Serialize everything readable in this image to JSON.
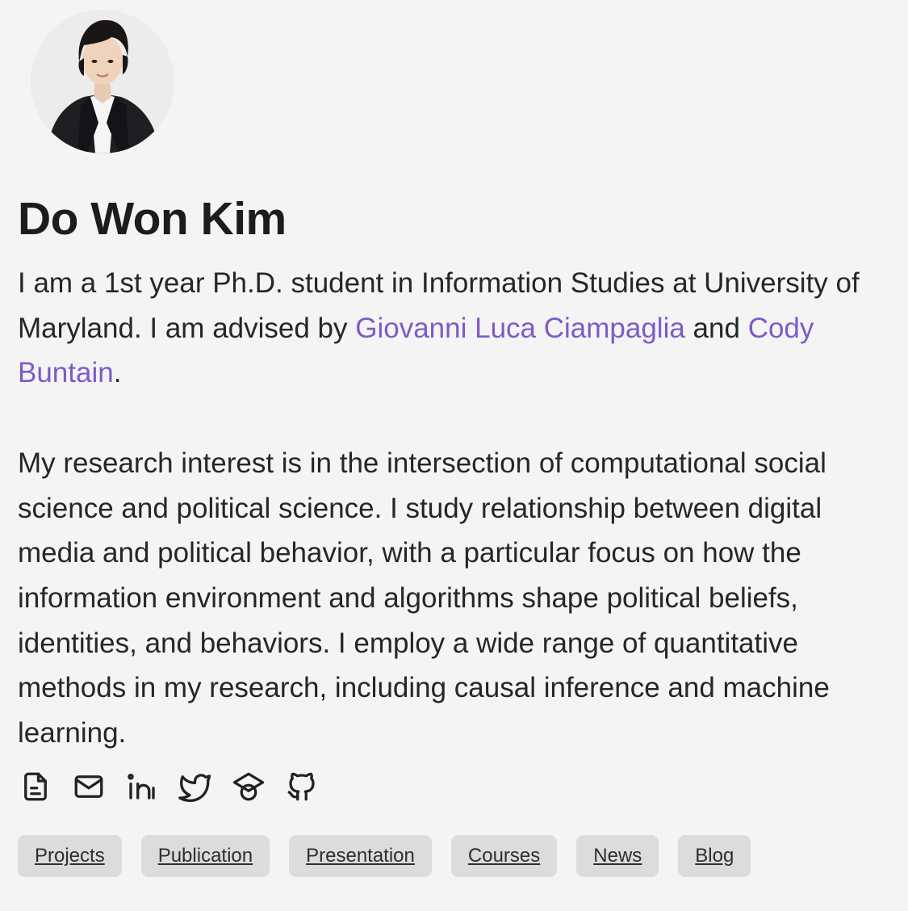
{
  "profile": {
    "name": "Do Won Kim",
    "avatar_alt": "Profile photo of Do Won Kim"
  },
  "bio": {
    "p1_part1": "I am a 1st year Ph.D. student in Information Studies at University of Maryland. I am advised by ",
    "advisor1": "Giovanni Luca Ciampaglia",
    "p1_part2": " and ",
    "advisor2": "Cody Buntain",
    "p1_part3": ".",
    "p2": "My research interest is in the intersection of computational social science and political science. I study relationship between digital media and political behavior, with a particular focus on how the information environment and algorithms shape political beliefs, identities, and behaviors. I employ a wide range of quantitative methods in my research, including causal inference and machine learning."
  },
  "links": [
    {
      "icon": "cv-document-icon"
    },
    {
      "icon": "email-icon"
    },
    {
      "icon": "linkedin-icon"
    },
    {
      "icon": "twitter-icon"
    },
    {
      "icon": "google-scholar-icon"
    },
    {
      "icon": "github-icon"
    }
  ],
  "nav": {
    "items": [
      "Projects",
      "Publication",
      "Presentation",
      "Courses",
      "News",
      "Blog"
    ]
  },
  "colors": {
    "background": "#f4f4f4",
    "text": "#1e1e1e",
    "link": "#7d5bc8",
    "tag_background": "#dcdcdc"
  }
}
